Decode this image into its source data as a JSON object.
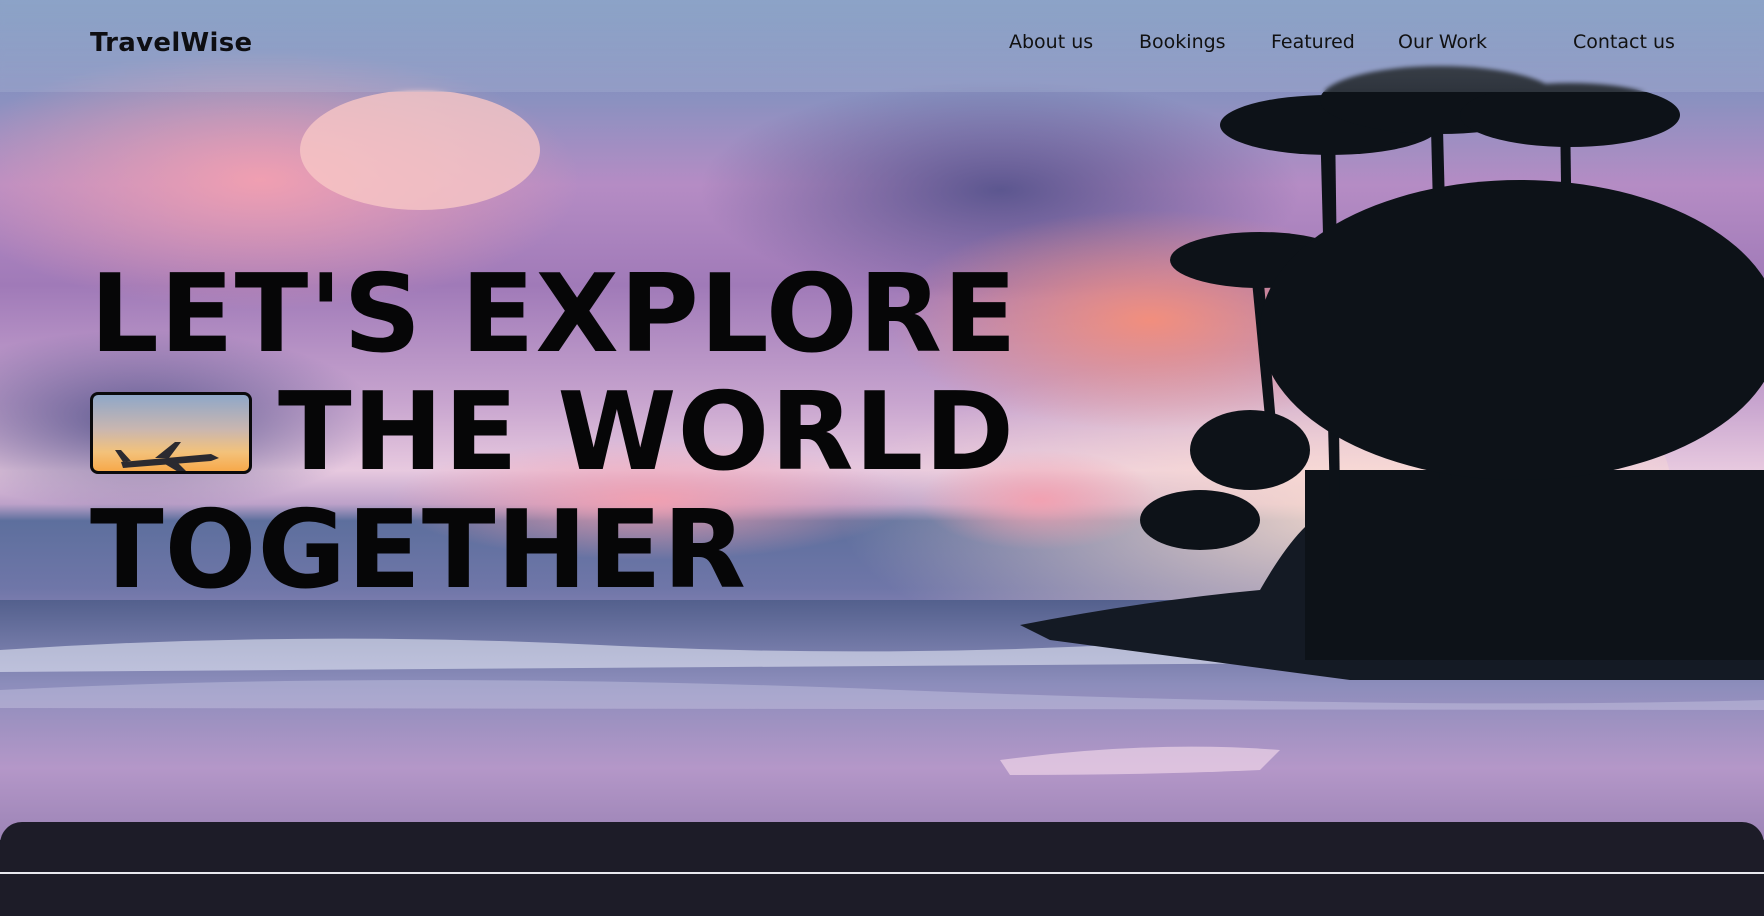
{
  "brand": "TravelWise",
  "nav": {
    "items": [
      {
        "label": "About us"
      },
      {
        "label": "Bookings"
      },
      {
        "label": "Featured"
      },
      {
        "label": "Our Work"
      },
      {
        "label": "Contact us"
      }
    ]
  },
  "hero": {
    "line1": "LET'S EXPLORE",
    "line2": "THE WORLD",
    "line3": "TOGETHER",
    "thumbnail_icon": "airplane-icon"
  },
  "colors": {
    "text": "#060607",
    "panel": "#1d1c28",
    "divider": "#e8e8ee"
  }
}
